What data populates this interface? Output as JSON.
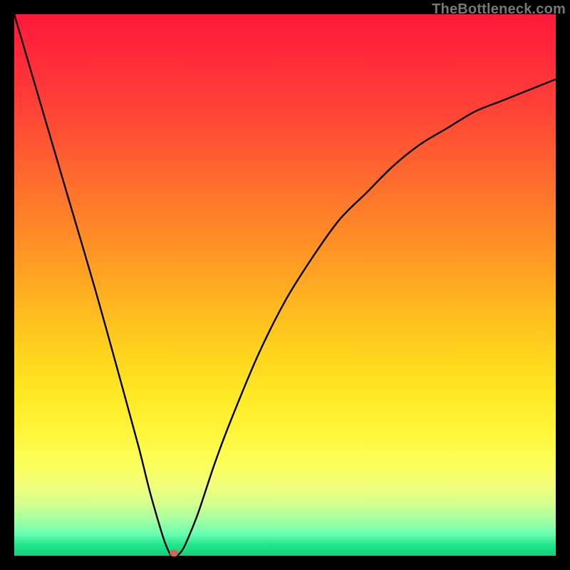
{
  "watermark": "TheBottleneck.com",
  "chart_data": {
    "type": "line",
    "title": "",
    "xlabel": "",
    "ylabel": "",
    "xlim": [
      0,
      100
    ],
    "ylim": [
      0,
      100
    ],
    "grid": false,
    "legend": false,
    "background_gradient": {
      "direction": "top-to-bottom",
      "stops": [
        {
          "pos": 0,
          "color": "#ff1a3a"
        },
        {
          "pos": 18,
          "color": "#ff4436"
        },
        {
          "pos": 42,
          "color": "#ff8f26"
        },
        {
          "pos": 62,
          "color": "#ffd21e"
        },
        {
          "pos": 83,
          "color": "#fcff5a"
        },
        {
          "pos": 93,
          "color": "#aaffa0"
        },
        {
          "pos": 100,
          "color": "#15cf7a"
        }
      ]
    },
    "series": [
      {
        "name": "bottleneck-curve",
        "x": [
          0,
          5,
          10,
          15,
          20,
          23,
          25,
          27,
          28,
          29,
          30,
          31,
          32,
          34,
          37,
          40,
          45,
          50,
          55,
          60,
          65,
          70,
          75,
          80,
          85,
          90,
          95,
          100
        ],
        "y": [
          100,
          83,
          66,
          49,
          31,
          20,
          12,
          5,
          2,
          0,
          0,
          1,
          3,
          8,
          17,
          25,
          37,
          47,
          55,
          62,
          67,
          72,
          76,
          79,
          82,
          84,
          86,
          88
        ]
      }
    ],
    "markers": [
      {
        "name": "optimal-point",
        "x": 29.5,
        "y": 0.5,
        "color": "#c86a5c"
      }
    ]
  }
}
